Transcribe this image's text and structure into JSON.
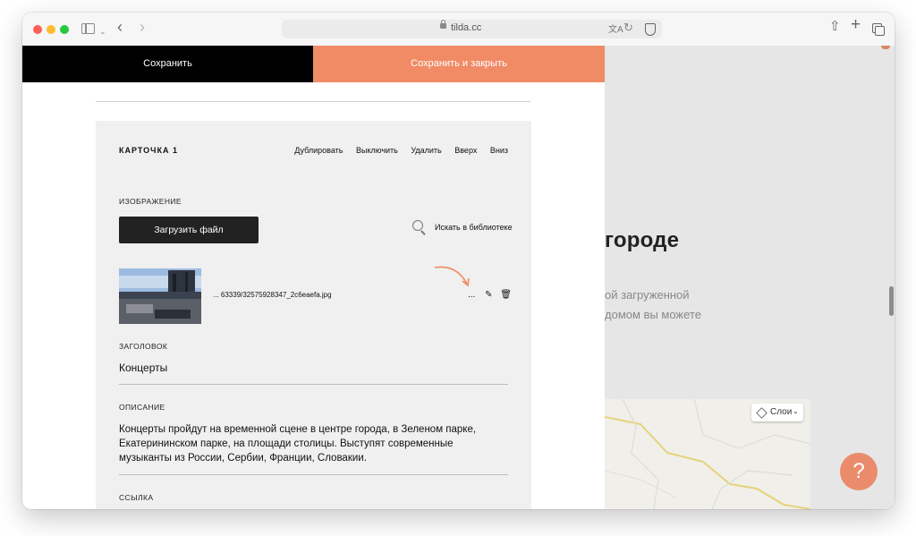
{
  "browser": {
    "url": "tilda.cc"
  },
  "editor": {
    "save_label": "Сохранить",
    "save_close_label": "Сохранить и закрыть",
    "card": {
      "title": "КАРТОЧКА 1",
      "actions": {
        "duplicate": "Дублировать",
        "disable": "Выключить",
        "delete": "Удалить",
        "up": "Вверх",
        "down": "Вниз"
      },
      "image_label": "ИЗОБРАЖЕНИЕ",
      "upload_label": "Загрузить файл",
      "search_library_label": "Искать в библиотеке",
      "file_name": "... 63339/32575928347_2c6eaefa.jpg",
      "more_label": "...",
      "heading_label": "ЗАГОЛОВОК",
      "heading_value": "Концерты",
      "description_label": "ОПИСАНИЕ",
      "description_value": "Концерты пройдут на временной сцене в центре города, в Зеленом парке, Екатерининском парке, на площади столицы. Выступят современные музыканты из России, Сербии, Франции, Словакии.",
      "link_label": "ССЫЛКА"
    }
  },
  "background_page": {
    "heading": "городе",
    "line1": "ой загруженной",
    "line2": "домом вы можете",
    "layers_label": "Слои",
    "help_label": "?"
  },
  "colors": {
    "accent": "#f08b66",
    "dark": "#000000"
  }
}
